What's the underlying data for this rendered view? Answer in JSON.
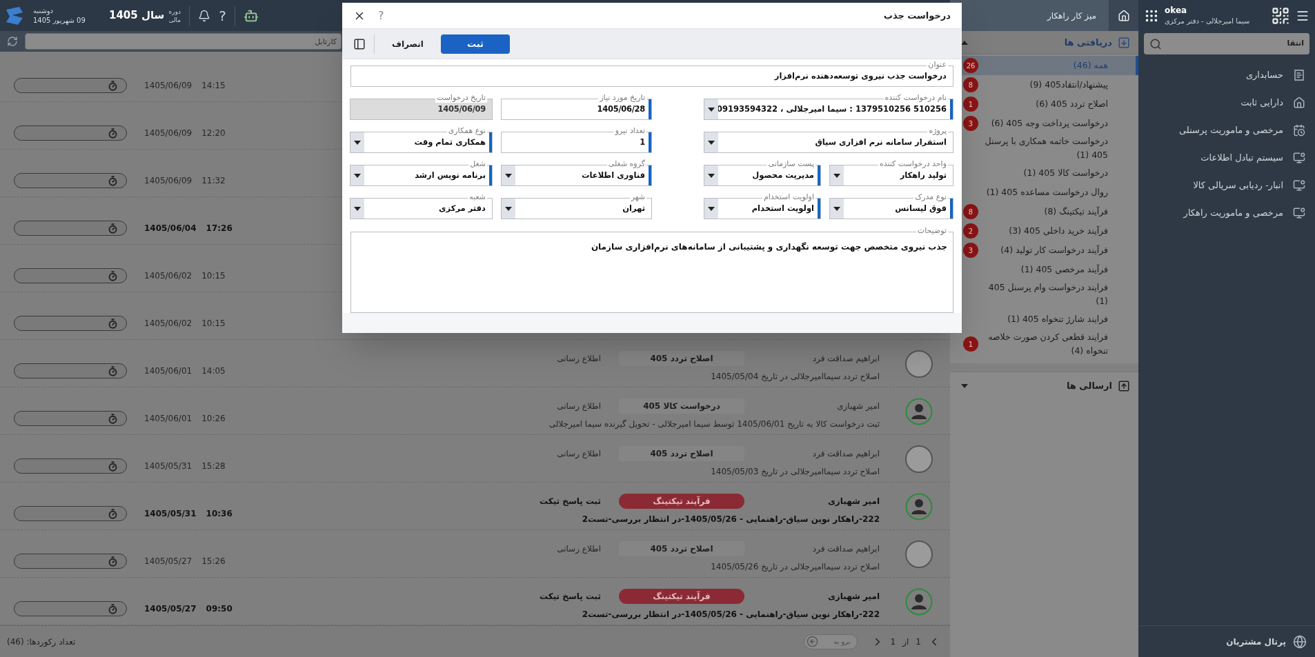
{
  "top_bar": {
    "day": "دوشنبه",
    "date": "09 شهریور 1405",
    "period_line_1": "دوره",
    "period_line_2": "مالی",
    "year": "سال 1405",
    "help": "?",
    "workspace_tab": "میز کار راهکار",
    "app_name": "okea",
    "user": "سیما امیرجلالی - دفتر مرکزی"
  },
  "list": {
    "search_placeholder": "کارتابل",
    "rows": [
      {
        "date": "1405/06/09",
        "time": "14:15",
        "unread": false
      },
      {
        "date": "1405/06/09",
        "time": "12:20",
        "unread": false
      },
      {
        "date": "1405/06/09",
        "time": "11:32",
        "unread": false
      },
      {
        "date": "1405/06/04",
        "time": "17:26",
        "unread": true
      },
      {
        "date": "1405/06/02",
        "time": "10:15",
        "unread": false
      },
      {
        "date": "1405/06/02",
        "time": "10:15",
        "unread": false
      },
      {
        "date": "1405/06/01",
        "time": "14:05",
        "unread": false,
        "sender": "ابراهیم صداقت فرد",
        "avatar": {
          "kind": "photo"
        },
        "subject": {
          "text": "اصلاح تردد 405",
          "kind": "plain"
        },
        "type": "اطلاع رسانی",
        "description": "اصلاح تردد سیماامیرجلالی در تاریخ 1405/05/04"
      },
      {
        "date": "1405/06/01",
        "time": "10:26",
        "unread": false,
        "sender": "امیر شهبازی",
        "avatar": {
          "kind": "silhouette"
        },
        "subject": {
          "text": "درخواست کالا 405",
          "kind": "plain"
        },
        "type": "اطلاع رسانی",
        "description": "ثبت درخواست کالا به تاریخ 1405/06/01 توسط سیما امیرجلالی - تحویل گیرنده سیما امیرجلالی"
      },
      {
        "date": "1405/05/31",
        "time": "15:28",
        "unread": false,
        "sender": "ابراهیم صداقت فرد",
        "avatar": {
          "kind": "photo"
        },
        "subject": {
          "text": "اصلاح تردد 405",
          "kind": "plain"
        },
        "type": "اطلاع رسانی",
        "description": "اصلاح تردد سیماامیرجلالی در تاریخ 1405/05/03"
      },
      {
        "date": "1405/05/31",
        "time": "10:36",
        "unread": true,
        "sender": "امیر شهبازی",
        "avatar": {
          "kind": "silhouette"
        },
        "subject": {
          "text": "فرآیند تیکتینگ",
          "kind": "tag"
        },
        "type": "ثبت پاسخ تیکت",
        "description": "222-راهکار نوین سیاق-راهنمایی - 1405/05/26-در انتظار بررسی-تست2"
      },
      {
        "date": "1405/05/27",
        "time": "15:26",
        "unread": false,
        "sender": "ابراهیم صداقت فرد",
        "avatar": {
          "kind": "photo"
        },
        "subject": {
          "text": "اصلاح تردد 405",
          "kind": "plain"
        },
        "type": "اطلاع رسانی",
        "description": "اصلاح تردد سیماامیرجلالی در تاریخ 1405/05/26"
      },
      {
        "date": "1405/05/27",
        "time": "09:50",
        "unread": true,
        "sender": "امیر شهبازی",
        "avatar": {
          "kind": "silhouette"
        },
        "subject": {
          "text": "فرآیند تیکتینگ",
          "kind": "tag"
        },
        "type": "ثبت پاسخ تیکت",
        "description": "222-راهکار نوین سیاق-راهنمایی - 1405/05/26-در انتظار بررسی-تست2"
      }
    ],
    "record_count": "تعداد رکوردها: (46)",
    "pagination": {
      "current": "1",
      "of": "از",
      "total": "1",
      "goto_placeholder": "برو به"
    }
  },
  "inbox_panel": {
    "received": {
      "title": "دریافتی ها",
      "expanded": true,
      "items": [
        {
          "label": "همه (46)",
          "badge": "26",
          "selected": true
        },
        {
          "label": "پیشنهاد/انتقاد405 (9)",
          "badge": "8",
          "selected": false
        },
        {
          "label": "اصلاح تردد 405 (6)",
          "badge": "1",
          "selected": false
        },
        {
          "label": "درخواست پرداخت وجه 405 (6)",
          "badge": "3",
          "selected": false
        },
        {
          "label": "درخواست خاتمه همکاری با پرسنل 405 (1)",
          "selected": false
        },
        {
          "label": "درخواست کالا 405 (1)",
          "selected": false
        },
        {
          "label": "روال درخواست مساعده 405 (1)",
          "selected": false
        },
        {
          "label": "فرآیند تیکتینگ (8)",
          "badge": "8",
          "selected": false
        },
        {
          "label": "فرآیند خرید داخلی 405 (3)",
          "badge": "2",
          "selected": false
        },
        {
          "label": "فرآیند درخواست کار تولید (4)",
          "badge": "3",
          "selected": false
        },
        {
          "label": "فرآیند مرخصی 405 (1)",
          "selected": false
        },
        {
          "label": "فرایند درخواست وام پرسنل 405 (1)",
          "selected": false
        },
        {
          "label": "فرایند شارژ تنخواه 405 (1)",
          "selected": false
        },
        {
          "label": "فرایند قطعی کردن صورت خلاصه تنخواه (4)",
          "badge": "1",
          "selected": false
        }
      ]
    },
    "sent": {
      "title": "ارسالی ها",
      "expanded": false
    }
  },
  "sidebar": {
    "search_value": "انتقا",
    "items": [
      {
        "label": "حسابداری",
        "kind": "receipt"
      },
      {
        "label": "دارایی ثابت",
        "kind": "house"
      },
      {
        "label": "مرخصی و ماموریت پرسنلی",
        "kind": "calendar"
      },
      {
        "label": "سیستم تبادل اطلاعات",
        "kind": "monitor"
      },
      {
        "label": "انبار- ردیابی سریالی کالا",
        "kind": "monitor"
      },
      {
        "label": "مرخصی و ماموریت راهکار",
        "kind": "monitor"
      }
    ],
    "footer": "پرتال مشتریان"
  },
  "dialog": {
    "title": "درخواست جذب",
    "help": "?",
    "submit": "ثبت",
    "cancel": "انصراف",
    "rows": [
      [
        {
          "label": "عنوان",
          "value": "درخواست جذب نیروی توسعه‌دهنده نرم‌افزار",
          "kind": "text",
          "required": false
        }
      ],
      [
        {
          "label": "نام درخواست کننده",
          "value": "510256 1379510256 : سیما امیرجلالی ، 09193594322",
          "kind": "select",
          "required": true
        },
        {
          "label": "تاریخ مورد نیاز",
          "value": "1405/06/28",
          "kind": "text",
          "required": true
        },
        {
          "label": "تاریخ درخواست",
          "value": "1405/06/09",
          "kind": "readonly",
          "required": false
        }
      ],
      [
        {
          "label": "پروژه",
          "value": "استقرار سامانه نرم افزاری سیاق",
          "kind": "select",
          "required": false
        },
        {
          "label": "تعداد نیرو",
          "value": "1",
          "kind": "text",
          "required": true
        },
        {
          "label": "نوع همکاری",
          "value": "همکاری تمام وقت",
          "kind": "select",
          "required": true
        }
      ],
      [
        {
          "label": "واحد درخواست کننده",
          "value": "تولید راهکار",
          "kind": "select",
          "required": false
        },
        {
          "label": "پست سازمانی",
          "value": "مدیریت محصول",
          "kind": "select",
          "required": true
        },
        {
          "label": "گروه شغلی",
          "value": "فناوری اطلاعات",
          "kind": "select",
          "required": true
        },
        {
          "label": "شغل",
          "value": "برنامه نویس ارشد",
          "kind": "select",
          "required": true
        }
      ],
      [
        {
          "label": "نوع مدرک",
          "value": "فوق لیسانس",
          "kind": "select",
          "required": true
        },
        {
          "label": "اولویت استخدام",
          "value": "اولویت استخدام",
          "kind": "select",
          "required": true
        },
        {
          "label": "شهر",
          "value": "تهران",
          "kind": "select",
          "required": false
        },
        {
          "label": "شعبه",
          "value": "دفتر مرکزی",
          "kind": "select",
          "required": false
        }
      ]
    ],
    "description": {
      "label": "توضیحات",
      "value": "جذب نیروی متخصص جهت توسعه نگهداری و پشتیبانی از سامانه‌های نرم‌افزاری سازمان"
    }
  }
}
